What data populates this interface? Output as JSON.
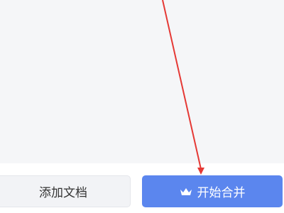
{
  "actions": {
    "add_document_label": "添加文档",
    "start_merge_label": "开始合并",
    "start_merge_icon": "crown-icon"
  },
  "colors": {
    "background": "#f5f6f8",
    "primary": "#5b86ee",
    "secondary_button": "#f2f3f6",
    "annotation_arrow": "#e53935"
  }
}
